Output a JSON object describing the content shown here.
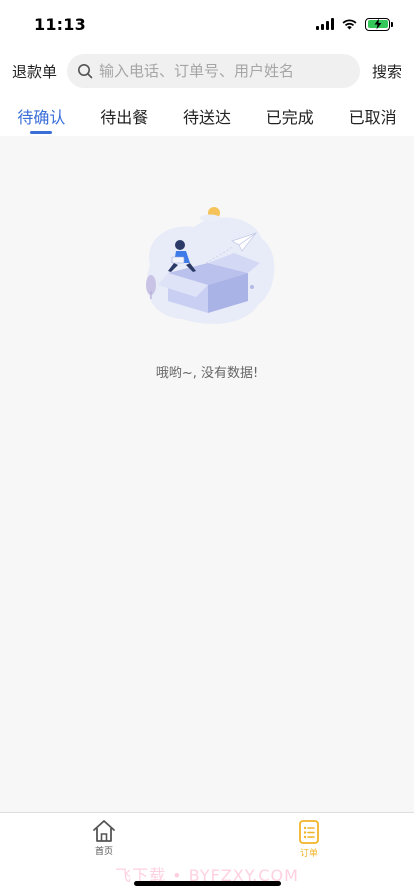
{
  "status_bar": {
    "time": "11:13"
  },
  "header": {
    "refund_label": "退款单",
    "search_placeholder": "输入电话、订单号、用户姓名",
    "search_value": "",
    "search_button": "搜索"
  },
  "tabs": [
    {
      "label": "待确认",
      "active": true
    },
    {
      "label": "待出餐",
      "active": false
    },
    {
      "label": "待送达",
      "active": false
    },
    {
      "label": "已完成",
      "active": false
    },
    {
      "label": "已取消",
      "active": false
    }
  ],
  "empty_state": {
    "message": "哦哟~, 没有数据!"
  },
  "bottom_nav": {
    "items": [
      {
        "label": "首页",
        "icon": "home-icon",
        "active": false
      },
      {
        "label": "订单",
        "icon": "order-list-icon",
        "active": true
      }
    ]
  },
  "watermark": "飞下载 • BYFZXY.COM",
  "colors": {
    "accent": "#3a6fd8",
    "orders_active": "#f0b429",
    "background": "#f7f7f7"
  }
}
